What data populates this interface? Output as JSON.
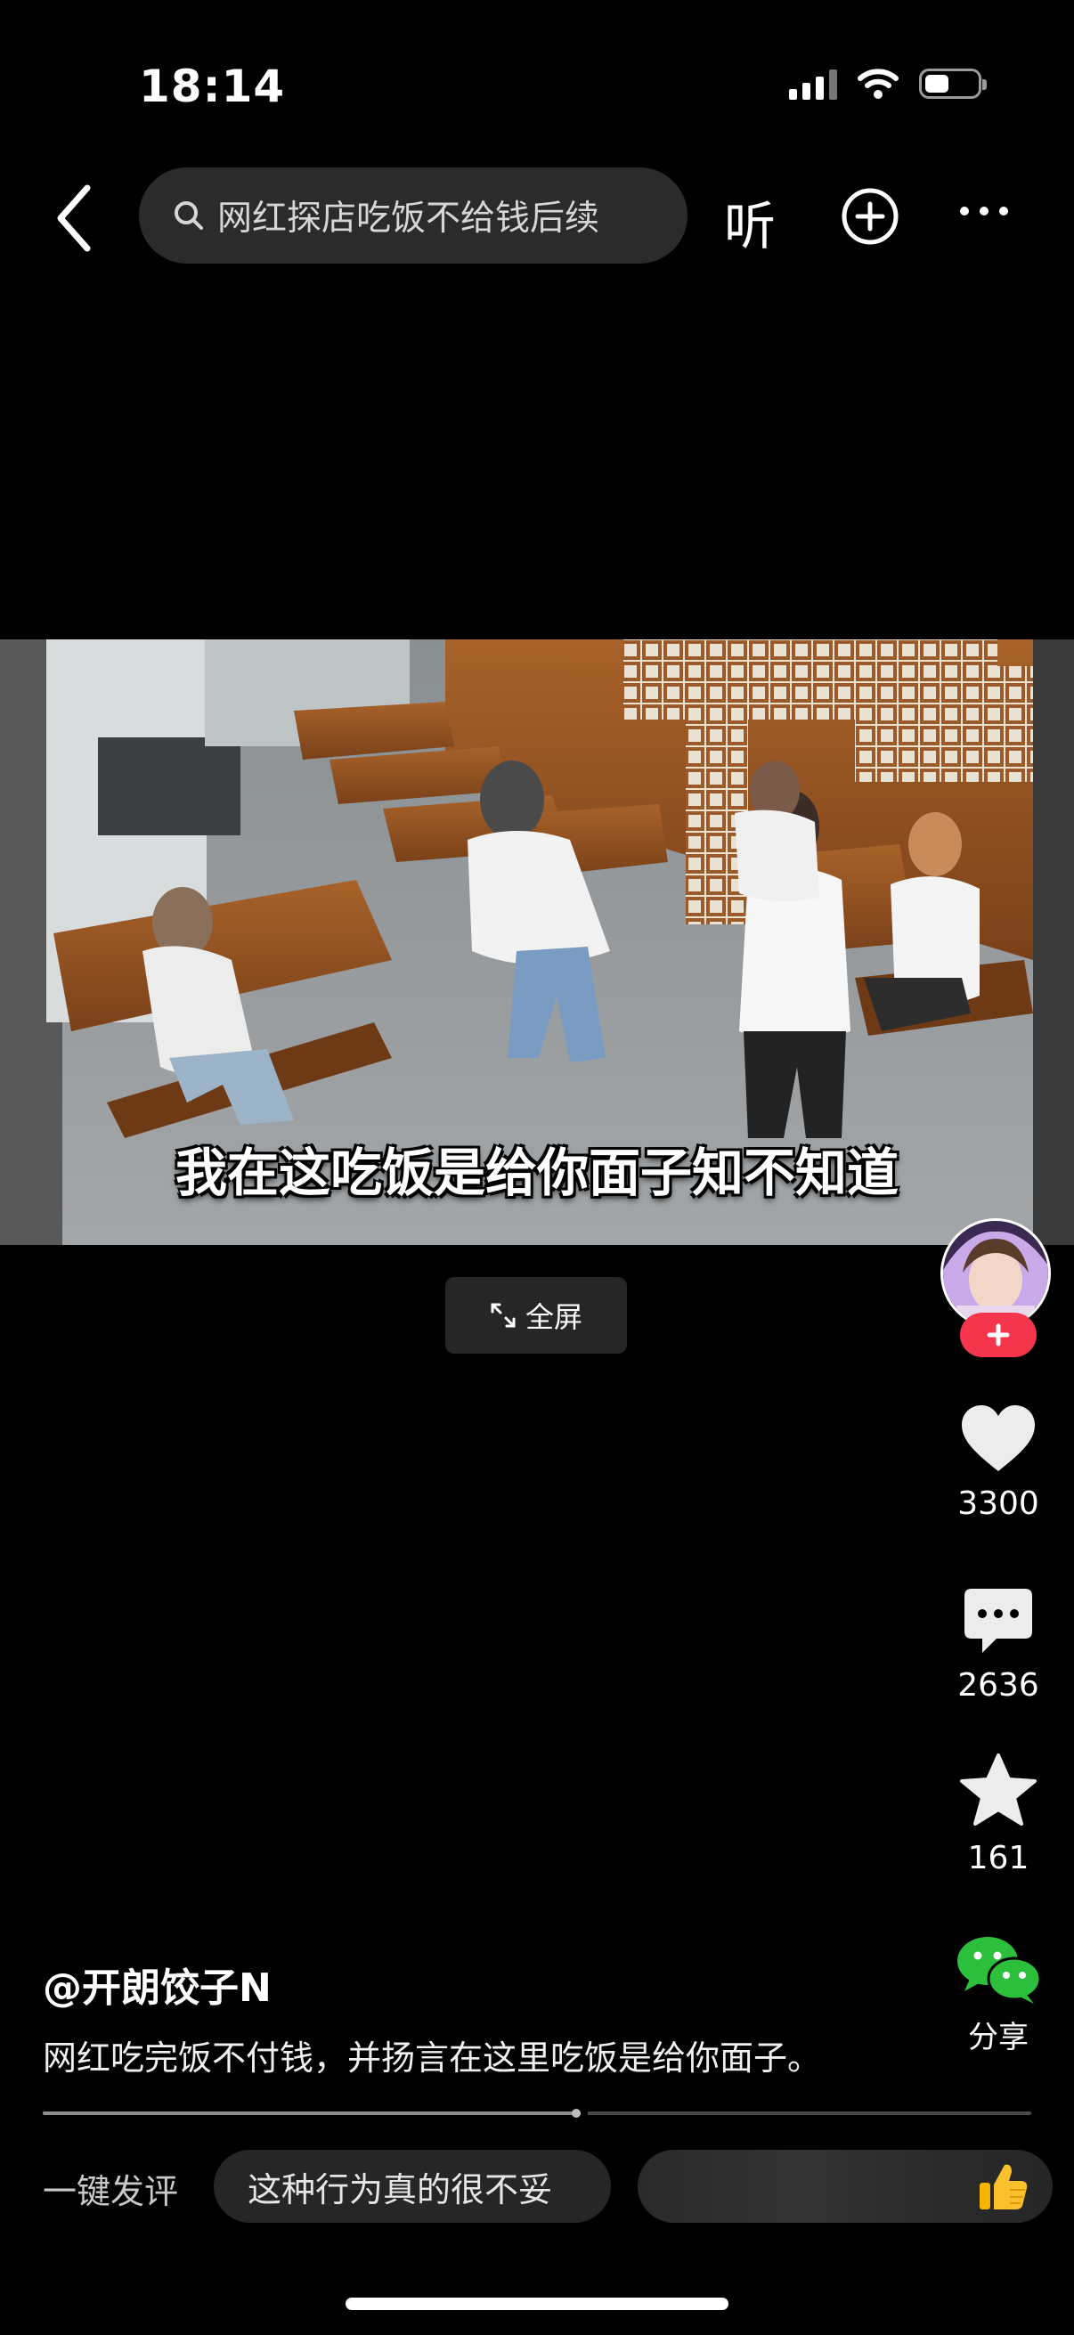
{
  "status_bar": {
    "time": "18:14"
  },
  "header": {
    "search_text": "网红探店吃饭不给钱后续",
    "listen_label": "听"
  },
  "video": {
    "subtitle": "我在这吃饭是给你面子知不知道",
    "fullscreen_label": "全屏"
  },
  "actions": {
    "likes": "3300",
    "comments": "2636",
    "favorites": "161",
    "share_label": "分享"
  },
  "post": {
    "author": "@开朗饺子N",
    "description": "网红吃完饭不付钱，并扬言在这里吃饭是给你面子。"
  },
  "progress": {
    "played_fraction": 0.54
  },
  "quick_comment": {
    "label": "一键发评",
    "suggestions": [
      "这种行为真的很不妥"
    ]
  },
  "colors": {
    "follow_red": "#f5354b",
    "wechat_green": "#2bbf3b"
  }
}
